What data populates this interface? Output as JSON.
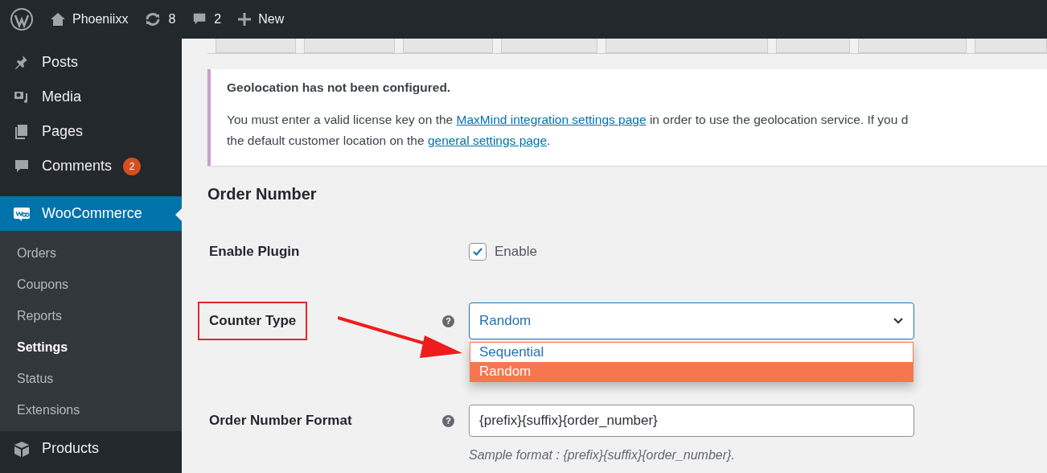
{
  "admin_bar": {
    "site": "Phoeniixx",
    "updates": "8",
    "comments": "2",
    "new": "New"
  },
  "sidebar": {
    "items": [
      {
        "label": "Posts",
        "selected": false
      },
      {
        "label": "Media",
        "selected": false
      },
      {
        "label": "Pages",
        "selected": false
      },
      {
        "label": "Comments",
        "badge": "2",
        "selected": false
      },
      {
        "label": "WooCommerce",
        "selected": true,
        "children": [
          {
            "label": "Orders",
            "selected": false
          },
          {
            "label": "Coupons",
            "selected": false
          },
          {
            "label": "Reports",
            "selected": false
          },
          {
            "label": "Settings",
            "selected": true
          },
          {
            "label": "Status",
            "selected": false
          },
          {
            "label": "Extensions",
            "selected": false
          }
        ]
      },
      {
        "label": "Products",
        "selected": false
      }
    ]
  },
  "notice": {
    "title": "Geolocation has not been configured.",
    "lines": [
      [
        {
          "kind": "text",
          "text": "You must enter a valid license key on the "
        },
        {
          "kind": "link",
          "text": "MaxMind integration settings page"
        },
        {
          "kind": "text",
          "text": " in order to use the geolocation service. If you d"
        }
      ],
      [
        {
          "kind": "text",
          "text": "the default customer location on the "
        },
        {
          "kind": "link",
          "text": "general settings page"
        },
        {
          "kind": "text",
          "text": "."
        }
      ]
    ]
  },
  "form": {
    "heading": "Order Number",
    "fields": [
      {
        "kind": "checkbox",
        "label": "Enable Plugin",
        "checked": true,
        "text": "Enable"
      },
      {
        "kind": "select",
        "label": "Counter Type",
        "help": "?",
        "annotated": true,
        "value": "Random",
        "expanded": true,
        "options": [
          {
            "label": "Sequential",
            "selected": false
          },
          {
            "label": "Random",
            "selected": true
          }
        ]
      },
      {
        "kind": "text",
        "label": "Order Number Format",
        "help": "?",
        "value": "{prefix}{suffix}{order_number}",
        "description": "Sample format : {prefix}{suffix}{order_number}."
      }
    ]
  }
}
